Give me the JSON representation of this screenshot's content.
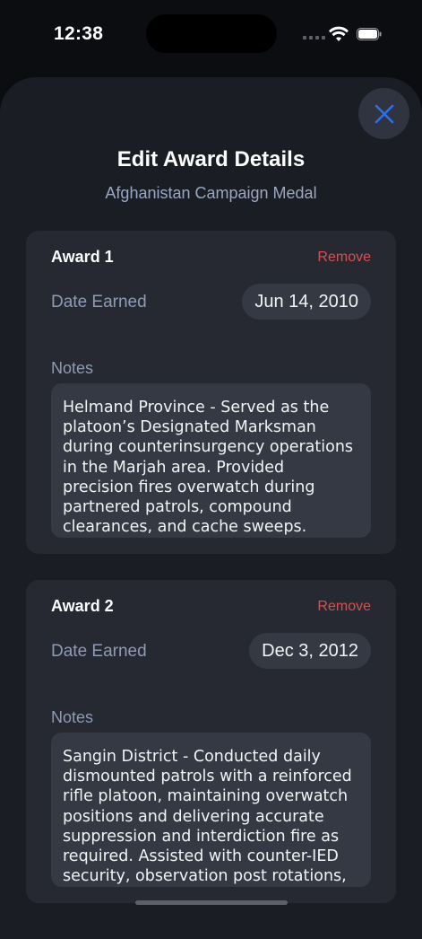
{
  "status_bar": {
    "time": "12:38"
  },
  "sheet": {
    "title": "Edit Award Details",
    "subtitle": "Afghanistan Campaign Medal",
    "close_icon": "close-x-icon"
  },
  "awards": [
    {
      "title": "Award 1",
      "remove_label": "Remove",
      "date_label": "Date Earned",
      "date_value": "Jun 14, 2010",
      "notes_label": "Notes",
      "notes_text": "Helmand Province - Served as the platoon’s Designated Marksman during counterinsurgency operations in the Marjah area. Provided precision fires overwatch during partnered patrols, compound clearances, and cache sweeps. Supported squad leaders with"
    },
    {
      "title": "Award 2",
      "remove_label": "Remove",
      "date_label": "Date Earned",
      "date_value": "Dec 3, 2012",
      "notes_label": "Notes",
      "notes_text": "Sangin District - Conducted daily dismounted patrols with a reinforced rifle platoon, maintaining overwatch positions and delivering accurate suppression and interdiction fire as required. Assisted with counter-IED security, observation post rotations,"
    }
  ],
  "colors": {
    "background": "#0b0d11",
    "sheet": "#1b1d24",
    "card": "#262932",
    "accent": "#2f6fe4",
    "remove": "#d65052",
    "muted_text": "#8f9bb4"
  }
}
